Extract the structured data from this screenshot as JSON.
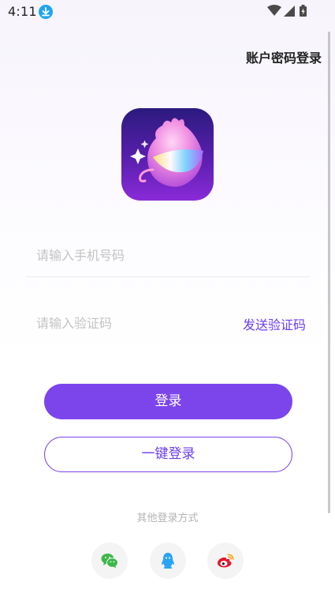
{
  "status_bar": {
    "time": "4:11",
    "icons": [
      "download-icon",
      "wifi-icon",
      "signal-icon",
      "battery-icon"
    ]
  },
  "header": {
    "password_login_label": "账户密码登录"
  },
  "form": {
    "phone_placeholder": "请输入手机号码",
    "code_placeholder": "请输入验证码",
    "send_code_label": "发送验证码"
  },
  "actions": {
    "login_label": "登录",
    "one_click_login_label": "一键登录"
  },
  "other_login": {
    "label": "其他登录方式",
    "methods": [
      "wechat-icon",
      "qq-icon",
      "weibo-icon"
    ]
  },
  "colors": {
    "accent": "#7c45ec",
    "wechat": "#3bb84a",
    "qq": "#2aa4f3",
    "weibo": "#e6162d"
  }
}
